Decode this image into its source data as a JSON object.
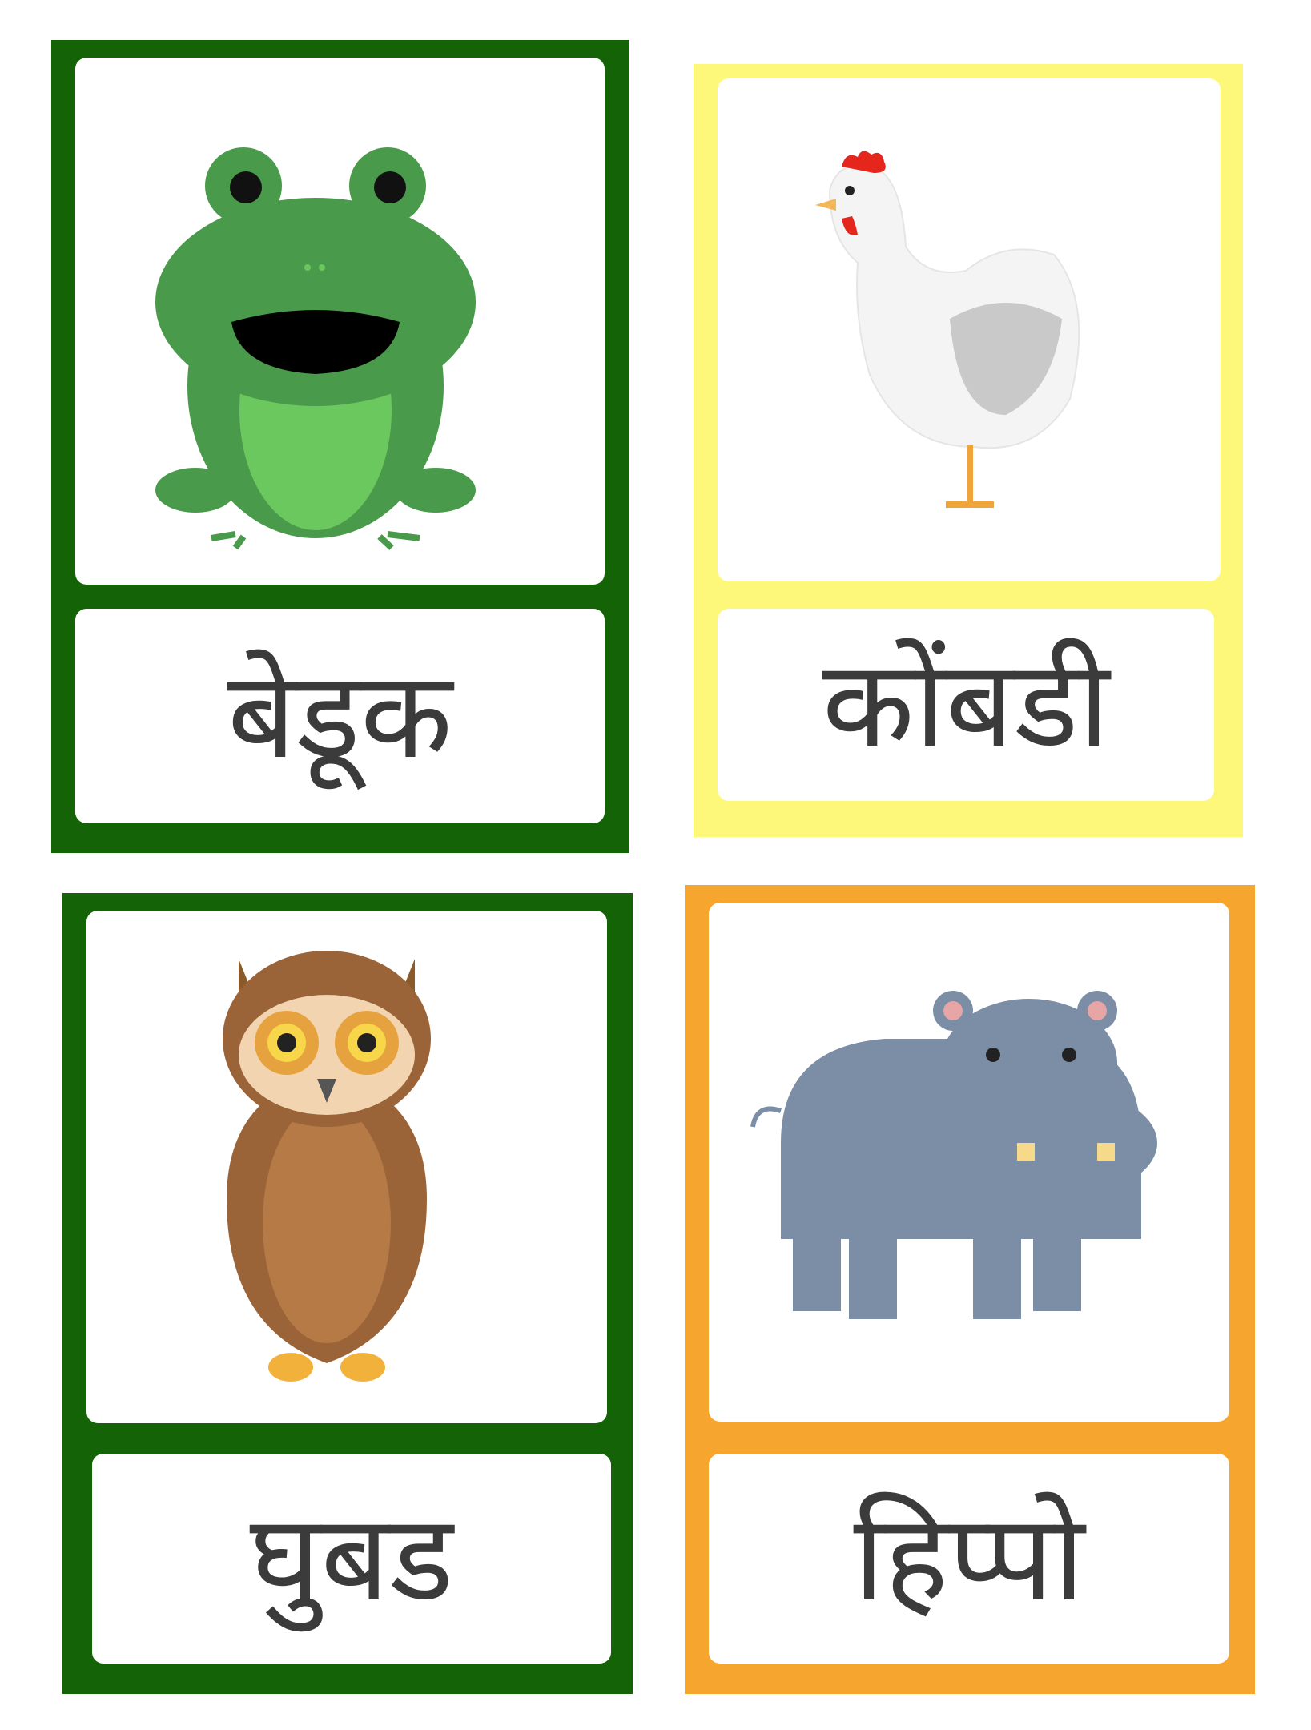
{
  "cards": [
    {
      "animal_icon": "frog-icon",
      "word": "बेडूक",
      "frame_color": "#156307"
    },
    {
      "animal_icon": "hen-icon",
      "word": "कोंबडी",
      "frame_color": "#fdf77a"
    },
    {
      "animal_icon": "owl-icon",
      "word": "घुबड",
      "frame_color": "#156307"
    },
    {
      "animal_icon": "hippo-icon",
      "word": "हिप्पो",
      "frame_color": "#f6a52e"
    }
  ]
}
